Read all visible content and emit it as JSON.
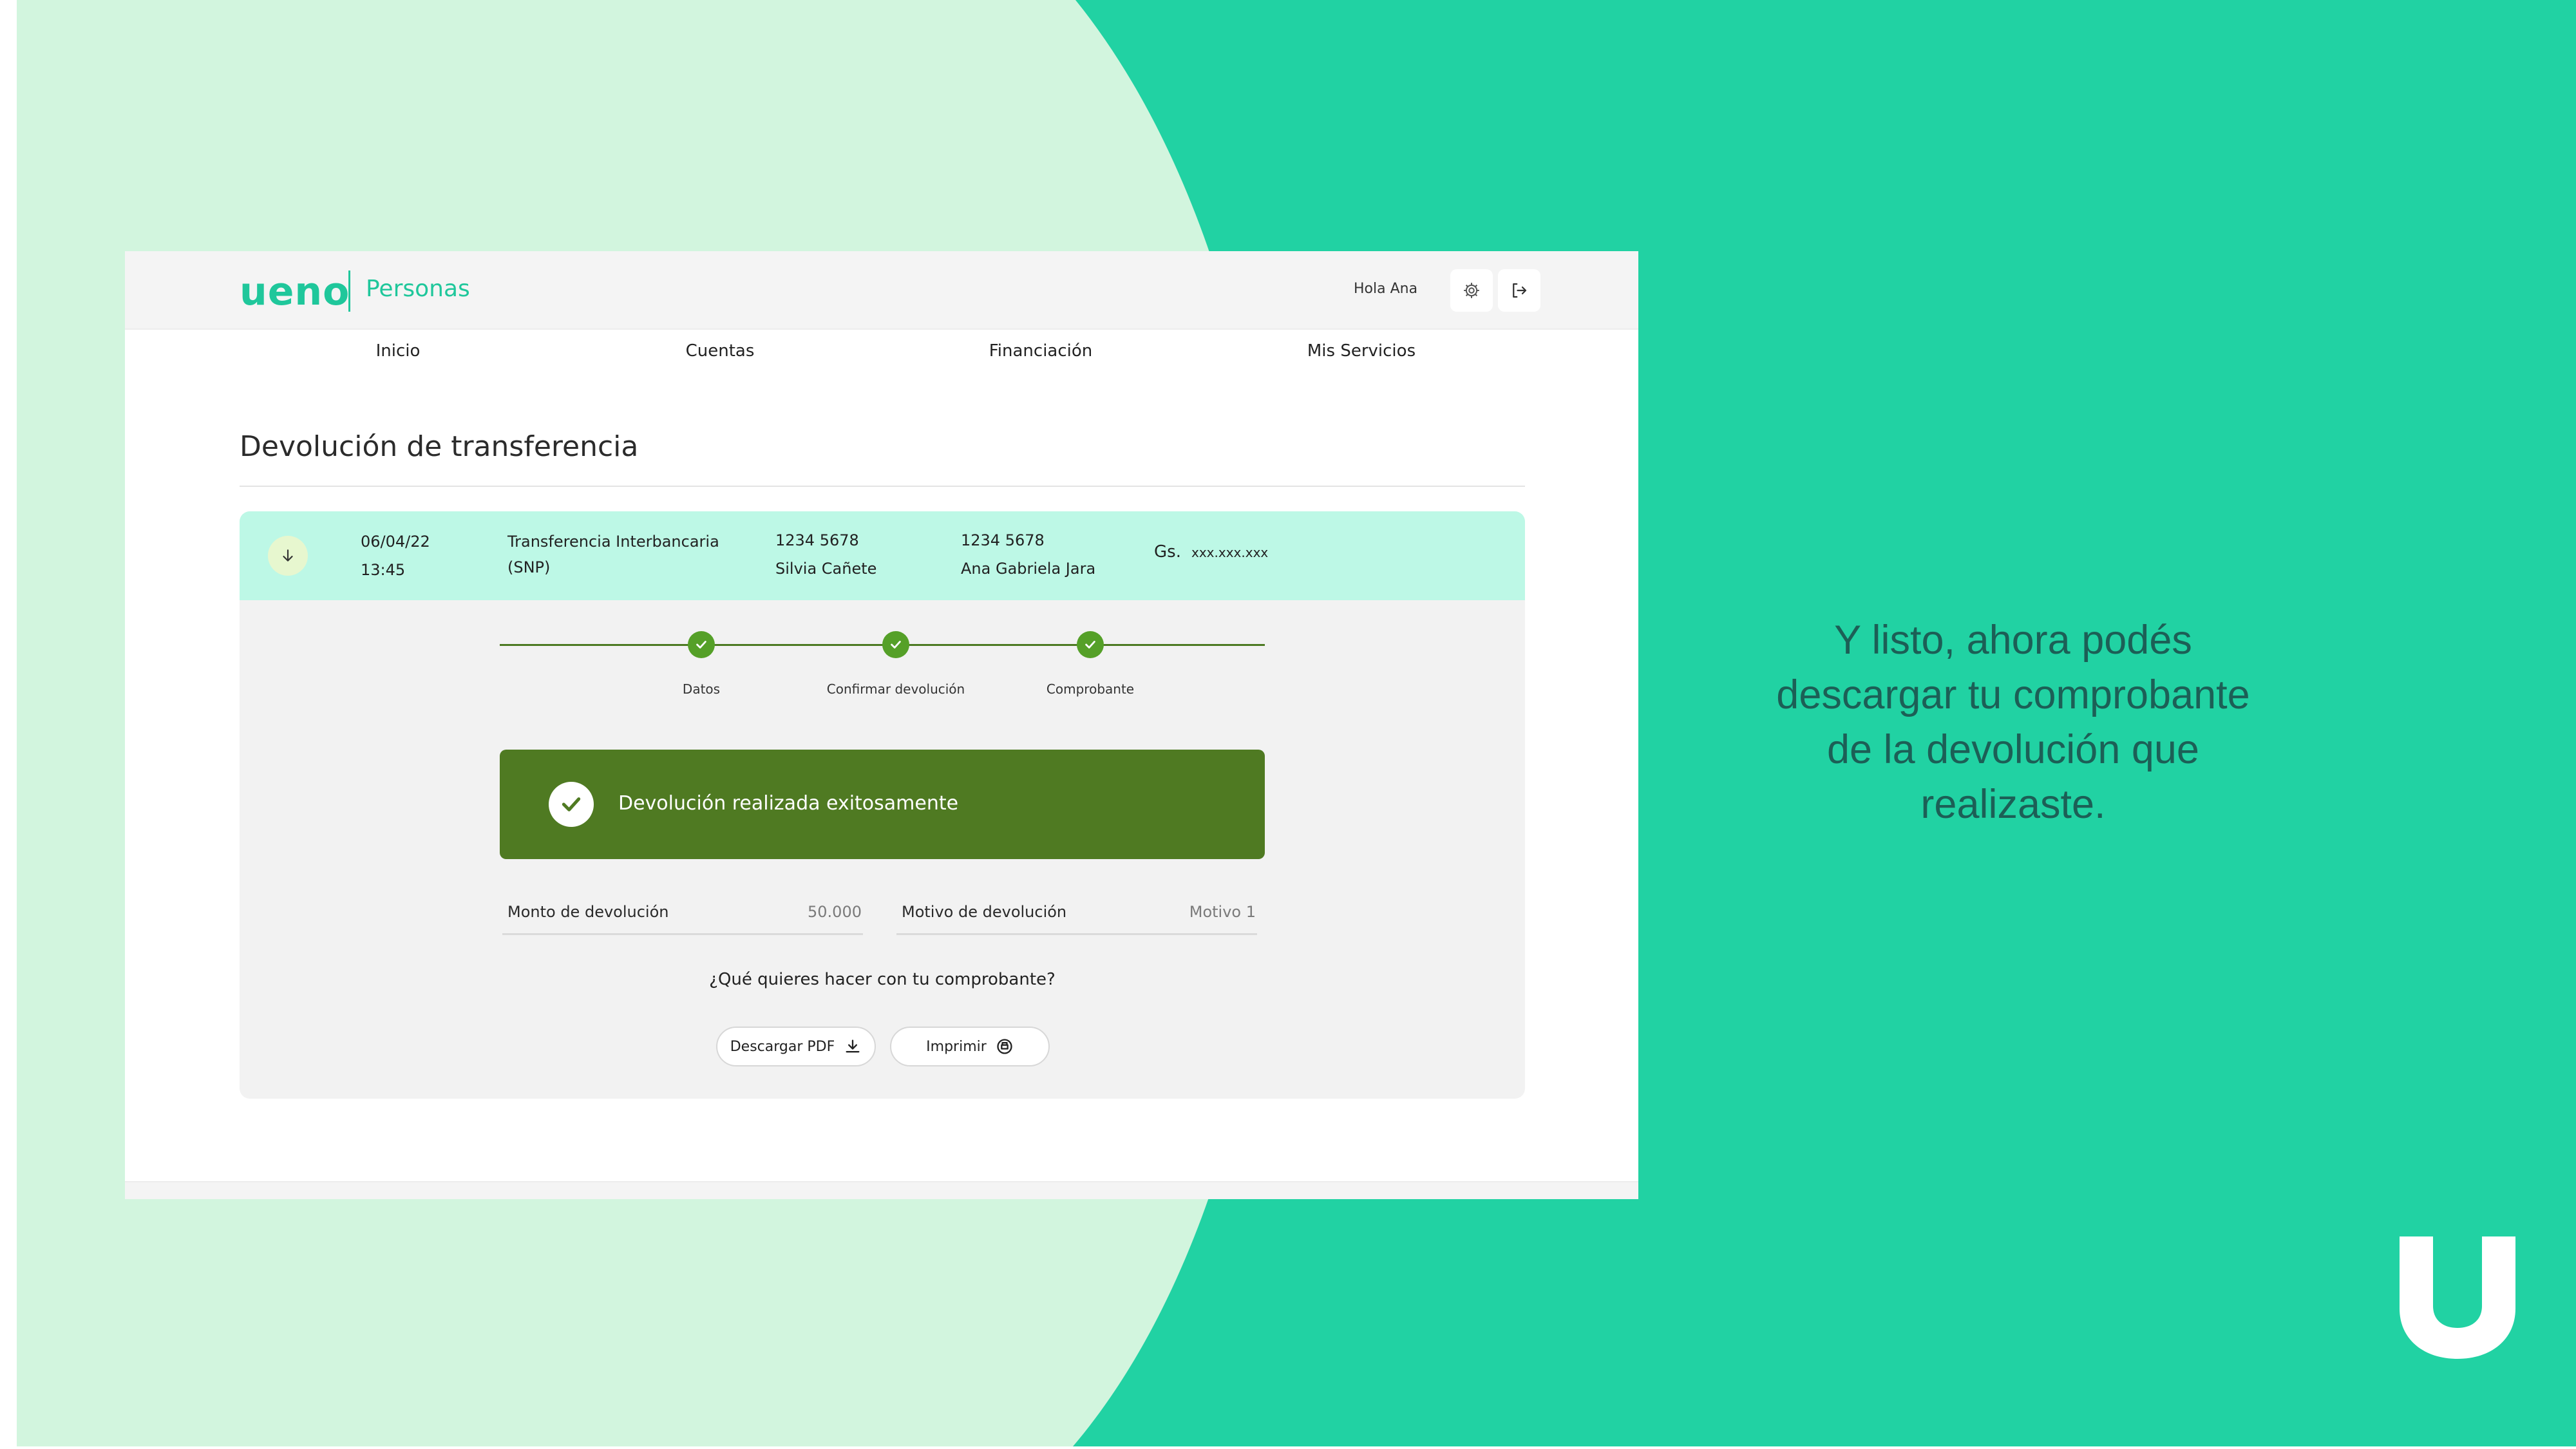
{
  "colors": {
    "slide_background": "#21d2a3",
    "light_arc": "#d2f5de",
    "brand": "#1fc79b",
    "success_banner": "#4f7a22",
    "step_complete": "#55a028",
    "transaction_row": "#bdf8e6",
    "caption_text": "#1c5f56"
  },
  "header": {
    "logo": "ueno",
    "brand_subtitle": "Personas",
    "greeting": "Hola Ana",
    "settings_icon": "gear-icon",
    "logout_icon": "logout-icon"
  },
  "nav": {
    "items": [
      "Inicio",
      "Cuentas",
      "Financiación",
      "Mis Servicios"
    ]
  },
  "page": {
    "title": "Devolución de transferencia"
  },
  "transaction": {
    "icon": "arrow-down-icon",
    "date": "06/04/22",
    "time": "13:45",
    "type_line1": "Transferencia Interbancaria",
    "type_line2": "(SNP)",
    "origin_account": "1234 5678",
    "origin_name": "Silvia Cañete",
    "destination_account": "1234 5678",
    "destination_name": "Ana Gabriela Jara",
    "currency": "Gs.",
    "amount": "xxx.xxx.xxx"
  },
  "stepper": {
    "steps": [
      {
        "label": "Datos",
        "status": "complete"
      },
      {
        "label": "Confirmar devolución",
        "status": "complete"
      },
      {
        "label": "Comprobante",
        "status": "complete"
      }
    ]
  },
  "success": {
    "icon": "check-circle-icon",
    "message": "Devolución realizada exitosamente"
  },
  "fields": {
    "amount_label": "Monto de devolución",
    "amount_value": "50.000",
    "reason_label": "Motivo de devolución",
    "reason_value": "Motivo 1"
  },
  "receipt": {
    "question": "¿Qué quieres hacer con tu comprobante?",
    "download_label": "Descargar PDF",
    "download_icon": "download-icon",
    "print_label": "Imprimir",
    "print_icon": "printer-icon"
  },
  "caption": {
    "lines": [
      "Y listo, ahora podés",
      "descargar tu comprobante",
      "de la devolución que",
      "realizaste."
    ]
  },
  "corner_logo_icon": "ueno-u-logo-icon"
}
